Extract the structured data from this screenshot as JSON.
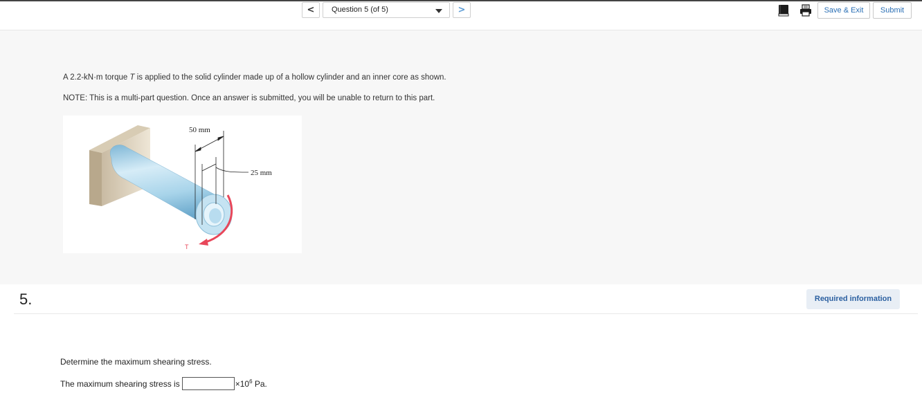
{
  "toolbar": {
    "prev_label": "<",
    "next_label": ">",
    "question_select": "Question 5 (of 5)",
    "book_icon": "book-icon",
    "print_icon": "print-icon",
    "save_exit_label": "Save & Exit",
    "submit_label": "Submit"
  },
  "info": {
    "line1_prefix": "A 2.2-kN·m torque ",
    "line1_var": "T",
    "line1_suffix": " is applied to the solid cylinder made up of a hollow cylinder and an inner core as shown.",
    "line2": "NOTE: This is a multi-part question. Once an answer is submitted, you will be unable to return to this part.",
    "figure": {
      "outer_dim": "50 mm",
      "inner_dim": "25 mm",
      "torque_label": "T"
    }
  },
  "question": {
    "number": "5.",
    "required_label": "Required information",
    "prompt": "Determine the maximum shearing stress.",
    "answer_prefix": "The maximum shearing stress is",
    "answer_value": "",
    "unit_prefix": "×10",
    "unit_exp": "6",
    "unit_suffix": " Pa."
  },
  "colors": {
    "accent": "#2a6fb5",
    "panel_bg": "#f7f7f7",
    "required_bg": "#e8eef5",
    "cylinder": "#a8d4ea",
    "torque_arrow": "#e8475a"
  }
}
